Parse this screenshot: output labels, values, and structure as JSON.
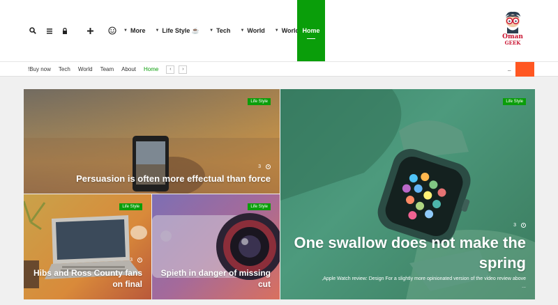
{
  "header": {
    "icons": [
      "search-icon",
      "menu-icon",
      "lock-icon",
      "plus-icon",
      "smiley-icon"
    ],
    "nav": [
      {
        "label": "More",
        "has_caret": true
      },
      {
        "label": "Life Style ☕",
        "has_caret": true
      },
      {
        "label": "Tech",
        "has_caret": true
      },
      {
        "label": "World",
        "has_caret": true
      },
      {
        "label": "World",
        "has_caret": true
      }
    ],
    "home_label": "Home",
    "logo": {
      "line1": "Oman",
      "line2": "GEEK"
    }
  },
  "subbar": {
    "links": [
      "!Buy now",
      "Tech",
      "World",
      "Team",
      "About",
      "Home"
    ],
    "prev": "‹",
    "next": "›",
    "dash": "_"
  },
  "cards": {
    "top_left": {
      "badge": "Life Style",
      "count": "3",
      "title": "Persuasion is often more effectual than force"
    },
    "big_right": {
      "badge": "Life Style",
      "count": "3",
      "title": "One swallow does not make the spring",
      "excerpt": ",Apple Watch review: Design For a slightly more opinionated version of the video review above",
      "ellipsis": "..."
    },
    "bottom_left": {
      "badge": "Life Style",
      "count": "3",
      "title": "Hibs and Ross County fans on final"
    },
    "bottom_mid": {
      "badge": "Life Style",
      "count": "",
      "title": "Spieth in danger of missing cut"
    }
  },
  "colors": {
    "accent_green": "#0a9e0a",
    "orange": "#ff5722"
  }
}
